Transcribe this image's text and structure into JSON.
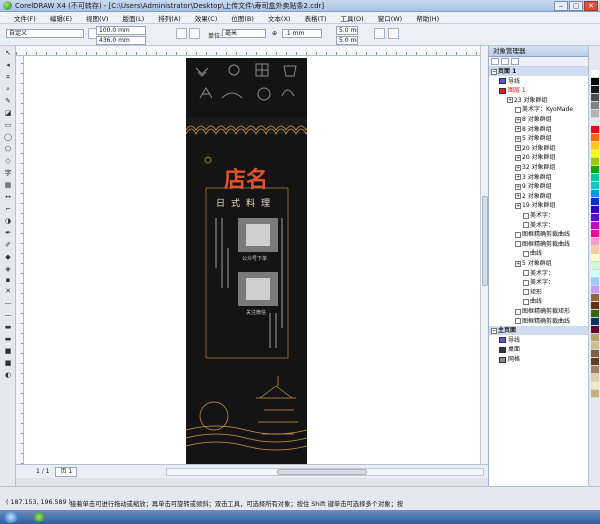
{
  "window": {
    "title": "CorelDRAW X4 (不可转存) - [C:\\Users\\Administrator\\Desktop\\上传文件\\寿司盒外卖贴条2.cdr]",
    "min": "‒",
    "max": "▢",
    "close": "✕"
  },
  "menu": [
    "文件(F)",
    "编辑(E)",
    "视图(V)",
    "版面(L)",
    "排列(A)",
    "效果(C)",
    "位图(B)",
    "文本(X)",
    "表格(T)",
    "工具(O)",
    "窗口(W)",
    "帮助(H)"
  ],
  "propbar": {
    "preset": "自定义",
    "width": "100.0 mm",
    "height": "436.0 mm",
    "units_label": "单位:",
    "units": "毫米",
    "nudge": ".1 mm",
    "dup_x": "5.0 mm",
    "dup_y": "5.0 mm"
  },
  "page_nav": {
    "counter": "1 / 1",
    "page_tab": "页 1"
  },
  "status": {
    "coords": "( 187.153, 196.589 )",
    "hint": "接着单击可进行拖动或缩放；再单击可旋转或倾斜；双击工具，可选择所有对象；按住 Shift 键单击可选择多个对象；按"
  },
  "object_manager": {
    "header": "对象管理器",
    "rows": [
      {
        "label": "页面 1",
        "level": 0,
        "type": "section"
      },
      {
        "label": "导线",
        "level": 1,
        "type": "layer",
        "swatch": "#5858c8"
      },
      {
        "label": "图层 1",
        "level": 1,
        "type": "layer-active",
        "swatch": "#d32020"
      },
      {
        "label": "23 对象群组",
        "level": 2,
        "type": "group"
      },
      {
        "label": "美术字：KyoMade",
        "level": 3,
        "type": "text"
      },
      {
        "label": "8 对象群组",
        "level": 3,
        "type": "group"
      },
      {
        "label": "8 对象群组",
        "level": 3,
        "type": "group"
      },
      {
        "label": "5 对象群组",
        "level": 3,
        "type": "group"
      },
      {
        "label": "20 对象群组",
        "level": 3,
        "type": "group"
      },
      {
        "label": "20 对象群组",
        "level": 3,
        "type": "group"
      },
      {
        "label": "32 对象群组",
        "level": 3,
        "type": "group"
      },
      {
        "label": "3 对象群组",
        "level": 3,
        "type": "group"
      },
      {
        "label": "9 对象群组",
        "level": 3,
        "type": "group"
      },
      {
        "label": "2 对象群组",
        "level": 3,
        "type": "group"
      },
      {
        "label": "19 对象群组",
        "level": 3,
        "type": "group"
      },
      {
        "label": "美术字：",
        "level": 4,
        "type": "text"
      },
      {
        "label": "美术字：",
        "level": 4,
        "type": "text"
      },
      {
        "label": "图框精确剪裁曲线",
        "level": 3,
        "type": "clip"
      },
      {
        "label": "图框精确剪裁曲线",
        "level": 3,
        "type": "clip"
      },
      {
        "label": "曲线",
        "level": 4,
        "type": "curve"
      },
      {
        "label": "5 对象群组",
        "level": 3,
        "type": "group"
      },
      {
        "label": "美术字：",
        "level": 4,
        "type": "text"
      },
      {
        "label": "美术字：",
        "level": 4,
        "type": "text"
      },
      {
        "label": "矩形",
        "level": 4,
        "type": "rect"
      },
      {
        "label": "曲线",
        "level": 4,
        "type": "curve"
      },
      {
        "label": "图框精确剪裁矩形",
        "level": 3,
        "type": "clip"
      },
      {
        "label": "图框精确剪裁曲线",
        "level": 3,
        "type": "clip"
      },
      {
        "label": "主页面",
        "level": 0,
        "type": "section"
      },
      {
        "label": "导线",
        "level": 1,
        "type": "layer",
        "swatch": "#5858c8"
      },
      {
        "label": "桌面",
        "level": 1,
        "type": "layer",
        "swatch": "#333333"
      },
      {
        "label": "网格",
        "level": 1,
        "type": "layer",
        "swatch": "#888888"
      }
    ]
  },
  "palette": [
    "#ffffff",
    "#000000",
    "#1a1a1a",
    "#4d4d4d",
    "#808080",
    "#b3b3b3",
    "#e6e6e6",
    "#ff0000",
    "#ff6600",
    "#ffcc00",
    "#ffff00",
    "#99cc00",
    "#00aa00",
    "#00cc99",
    "#00cccc",
    "#0099ff",
    "#0033cc",
    "#3300cc",
    "#6600cc",
    "#cc00cc",
    "#ff0099",
    "#ff99cc",
    "#ffcc99",
    "#ffffcc",
    "#ccffcc",
    "#ccffff",
    "#99ccff",
    "#cc99ff",
    "#996633",
    "#663300",
    "#336600",
    "#003366",
    "#660033",
    "#c0a060",
    "#d0c080",
    "#806040",
    "#604020",
    "#a08060",
    "#e0d0a0",
    "#f0e8c8",
    "#c8b078"
  ],
  "design": {
    "title": "店名",
    "subtitle": [
      "日",
      "式",
      "料",
      "理"
    ],
    "qr1_caption": "公众号下单",
    "qr2_caption": "关注微信"
  }
}
